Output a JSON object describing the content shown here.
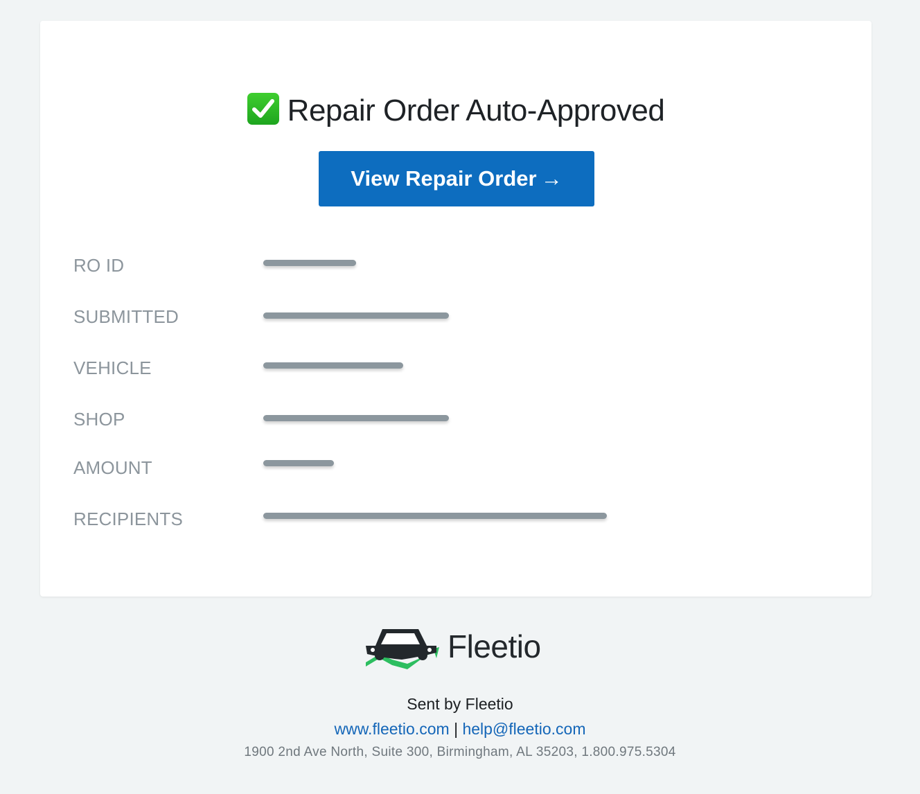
{
  "card": {
    "title": "Repair Order Auto-Approved",
    "button_label": "View Repair Order",
    "button_arrow": "→",
    "fields": [
      {
        "label": "RO ID"
      },
      {
        "label": "SUBMITTED"
      },
      {
        "label": "VEHICLE"
      },
      {
        "label": "SHOP"
      },
      {
        "label": "AMOUNT"
      },
      {
        "label": "RECIPIENTS"
      }
    ]
  },
  "footer": {
    "logo_text": "Fleetio",
    "sent_by": "Sent by Fleetio",
    "website": "www.fleetio.com",
    "separator": "|",
    "email": "help@fleetio.com",
    "address": "1900 2nd Ave North, Suite 300, Birmingham, AL 35203, 1.800.975.5304"
  },
  "colors": {
    "button": "#0d6dbf",
    "check_green": "#2fbd29",
    "logo_green": "#2dbe60",
    "link": "#1466b8"
  },
  "icons": {
    "title_icon": "check-mark-icon",
    "logo_icon": "fleetio-car-icon"
  }
}
